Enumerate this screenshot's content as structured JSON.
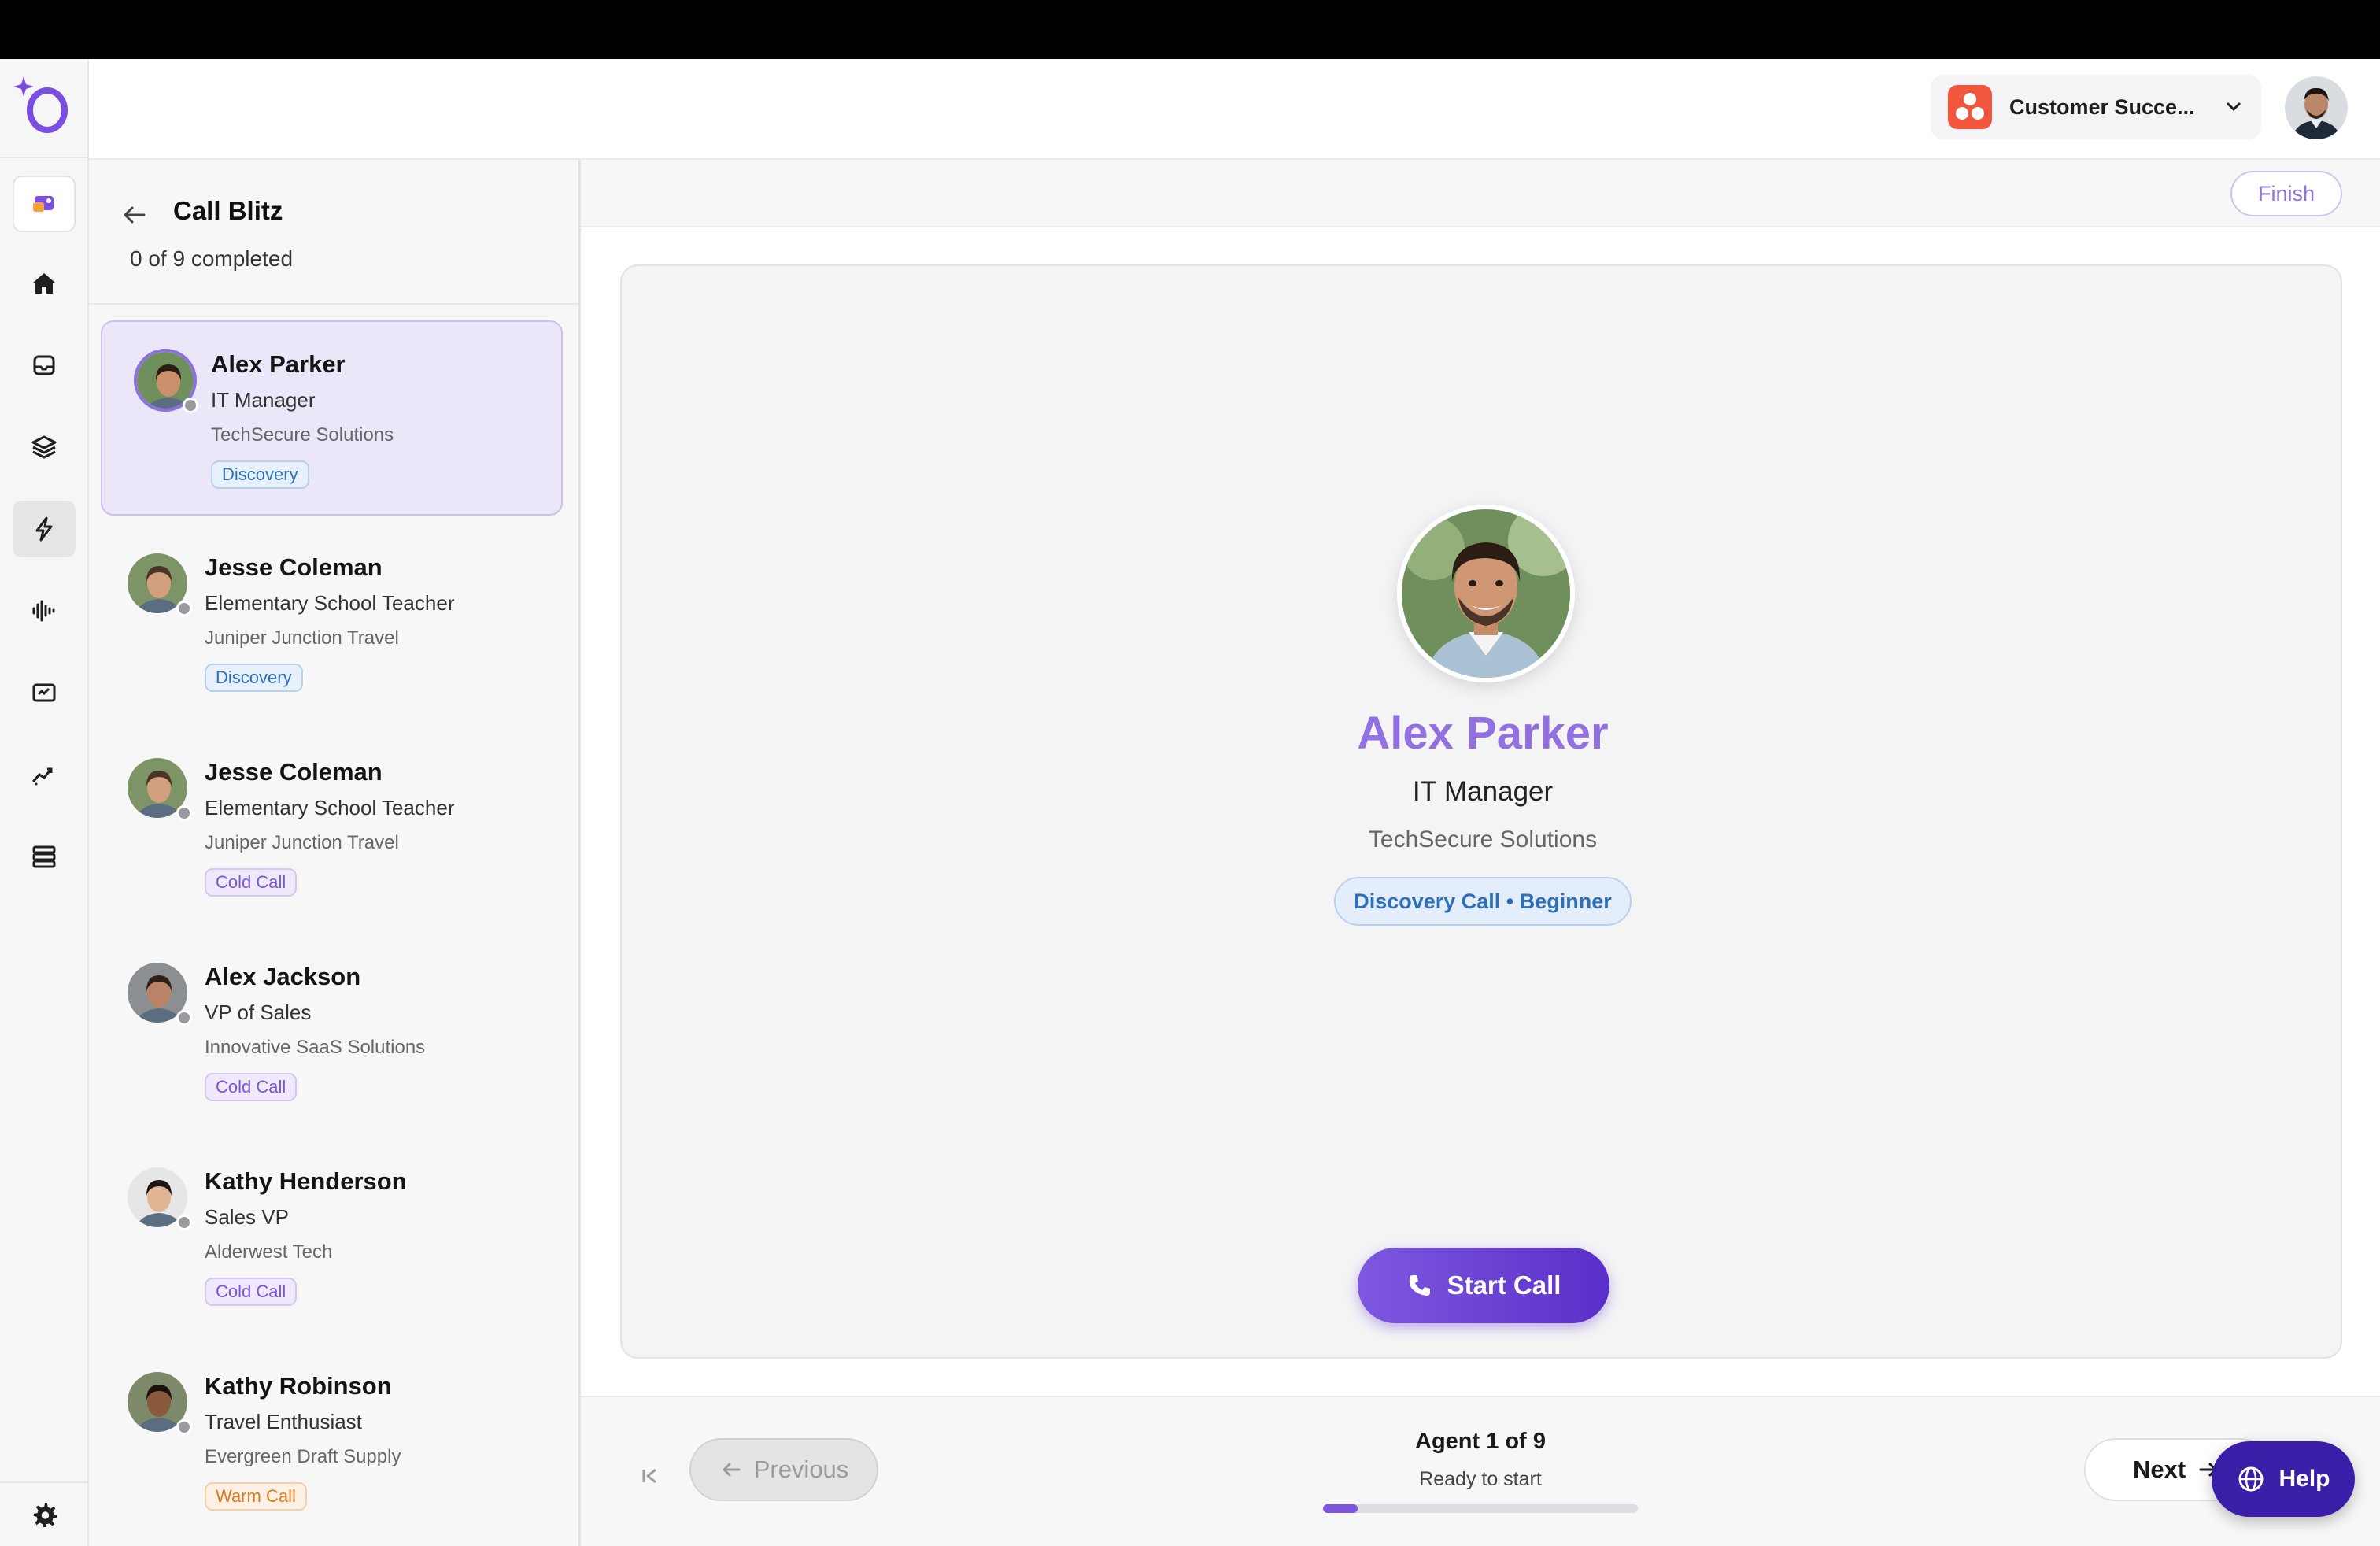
{
  "header": {
    "workspace_label": "Customer Succe...",
    "workspace_icon": "asana-logo-icon",
    "avatar": "user-avatar"
  },
  "rail": {
    "items": [
      "app-tile-icon",
      "home-icon",
      "inbox-icon",
      "layers-icon",
      "bolt-icon",
      "waveform-icon",
      "presentation-icon",
      "analytics-icon",
      "database-icon"
    ],
    "active": "bolt-icon",
    "settings": "gear-icon"
  },
  "list": {
    "title": "Call Blitz",
    "progress": "0 of 9 completed",
    "agents": [
      {
        "name": "Alex Parker",
        "role": "IT Manager",
        "company": "TechSecure Solutions",
        "tag": "Discovery",
        "tag_type": "discovery",
        "selected": true
      },
      {
        "name": "Jesse Coleman",
        "role": "Elementary School Teacher",
        "company": "Juniper Junction Travel",
        "tag": "Discovery",
        "tag_type": "discovery"
      },
      {
        "name": "Jesse Coleman",
        "role": "Elementary School Teacher",
        "company": "Juniper Junction Travel",
        "tag": "Cold Call",
        "tag_type": "cold"
      },
      {
        "name": "Alex Jackson",
        "role": "VP of Sales",
        "company": "Innovative SaaS Solutions",
        "tag": "Cold Call",
        "tag_type": "cold"
      },
      {
        "name": "Kathy Henderson",
        "role": "Sales VP",
        "company": "Alderwest Tech",
        "tag": "Cold Call",
        "tag_type": "cold"
      },
      {
        "name": "Kathy Robinson",
        "role": "Travel Enthusiast",
        "company": "Evergreen Draft Supply",
        "tag": "Warm Call",
        "tag_type": "warm"
      }
    ]
  },
  "main": {
    "finish_label": "Finish",
    "current": {
      "name": "Alex Parker",
      "role": "IT Manager",
      "company": "TechSecure Solutions",
      "tag": "Discovery Call • Beginner"
    },
    "start_call_label": "Start Call",
    "footer": {
      "previous_label": "Previous",
      "next_label": "Next",
      "agent_label": "Agent 1 of 9",
      "status": "Ready to start",
      "progress_fraction": 0.111
    },
    "help_label": "Help"
  },
  "colors": {
    "accent": "#7e58e0",
    "brand_dark": "#3b1ea8"
  }
}
